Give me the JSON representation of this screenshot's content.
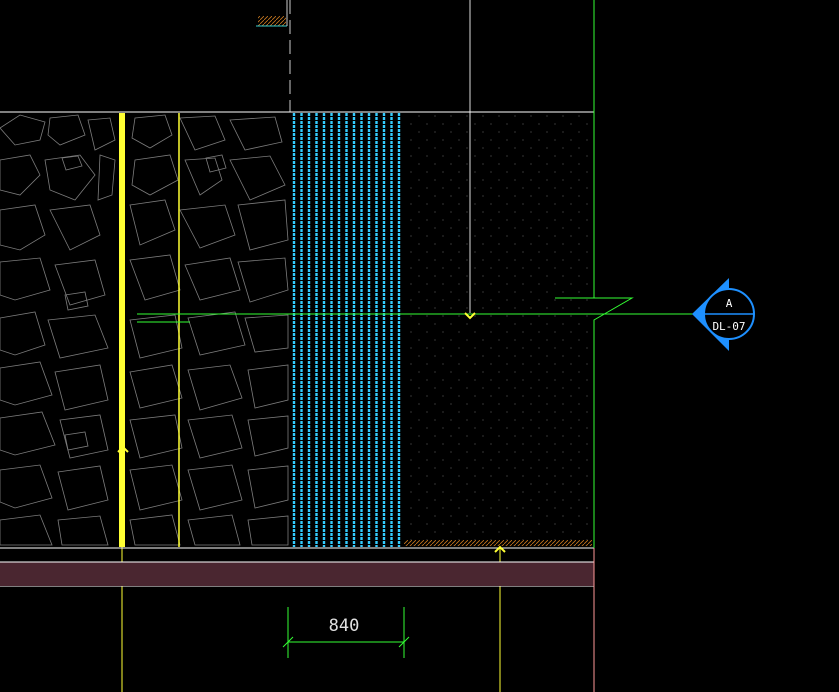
{
  "dimension": {
    "value_text": "840"
  },
  "section_marker": {
    "letter": "A",
    "sheet": "DL-07"
  },
  "colors": {
    "background": "#000000",
    "outline": "#ffffff",
    "stone_pattern": "#8a8a8a",
    "yellow": "#ffff33",
    "cyan": "#33ccff",
    "green": "#33ff33",
    "maroon_band": "#4a2630",
    "blue_marker": "#1e90ff",
    "hatch_orange": "#c87820"
  }
}
